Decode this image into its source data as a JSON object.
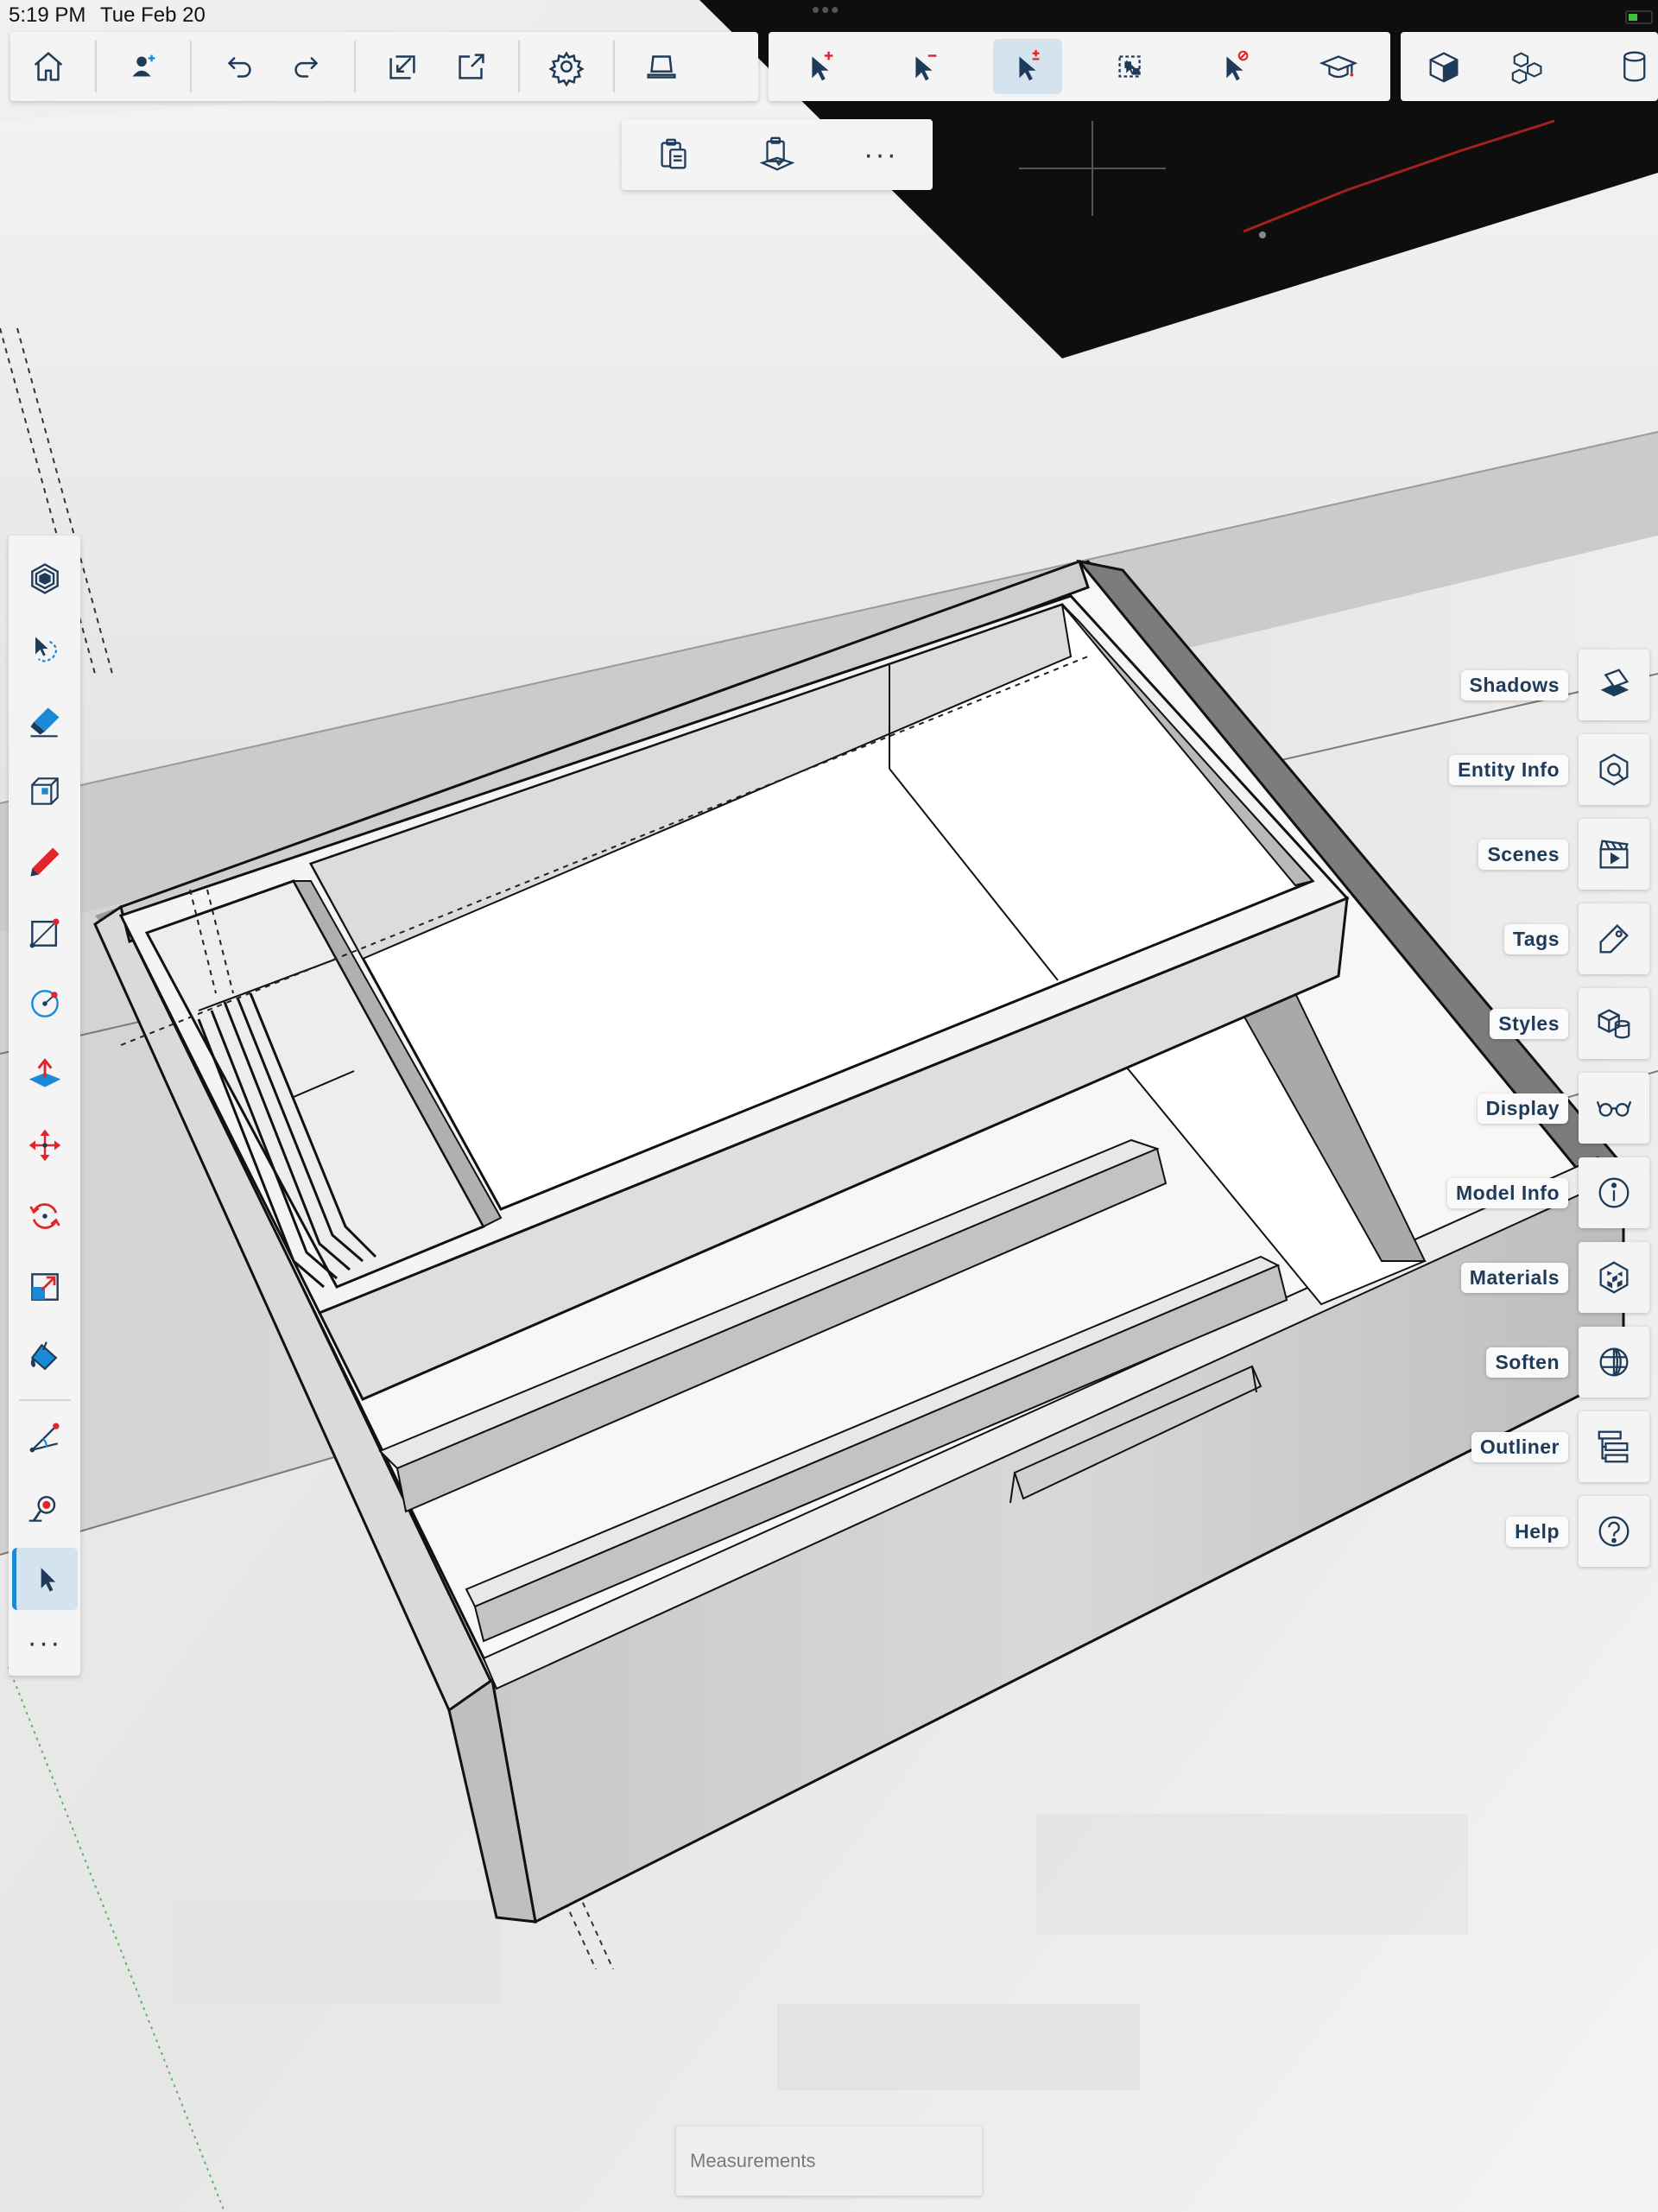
{
  "status_bar": {
    "time": "5:19 PM",
    "date": "Tue Feb 20",
    "dots": "•••"
  },
  "top_toolbar": {
    "file_group": [
      {
        "name": "home-button",
        "icon": "home-icon"
      },
      {
        "name": "collaborate-button",
        "icon": "user-add-icon"
      },
      {
        "name": "undo-button",
        "icon": "undo-icon"
      },
      {
        "name": "redo-button",
        "icon": "redo-icon"
      },
      {
        "name": "import-button",
        "icon": "import-icon"
      },
      {
        "name": "export-button",
        "icon": "export-icon"
      },
      {
        "name": "settings-button",
        "icon": "gear-icon"
      },
      {
        "name": "view-button",
        "icon": "laptop-icon"
      }
    ],
    "select_group": [
      {
        "name": "select-add-button",
        "icon": "cursor-plus-icon"
      },
      {
        "name": "select-subtract-button",
        "icon": "cursor-minus-icon"
      },
      {
        "name": "select-toggle-button",
        "icon": "cursor-plus-minus-icon",
        "active": true
      },
      {
        "name": "select-all-button",
        "icon": "select-grid-icon"
      },
      {
        "name": "select-none-button",
        "icon": "cursor-block-icon"
      },
      {
        "name": "instructor-button",
        "icon": "graduation-cap-icon"
      }
    ],
    "view_group": [
      {
        "name": "standard-views-button",
        "icon": "cube-icon"
      },
      {
        "name": "components-button",
        "icon": "components-icon"
      },
      {
        "name": "library-button",
        "icon": "cylinder-icon"
      }
    ]
  },
  "sub_toolbar": {
    "items": [
      {
        "name": "paste-button",
        "icon": "clipboard-icon"
      },
      {
        "name": "paste-in-place-button",
        "icon": "clipboard-place-icon"
      }
    ],
    "more_label": "···"
  },
  "left_tools": {
    "items": [
      {
        "name": "orbit-tool",
        "icon": "orbit-icon"
      },
      {
        "name": "lasso-select-tool",
        "icon": "lasso-icon"
      },
      {
        "name": "eraser-tool",
        "icon": "eraser-icon"
      },
      {
        "name": "shape-tool",
        "icon": "box-icon"
      },
      {
        "name": "pencil-tool",
        "icon": "pencil-icon"
      },
      {
        "name": "rectangle-tool",
        "icon": "rectangle-icon"
      },
      {
        "name": "circle-tool",
        "icon": "circle-icon"
      },
      {
        "name": "push-pull-tool",
        "icon": "push-pull-icon"
      },
      {
        "name": "move-tool",
        "icon": "move-arrows-icon"
      },
      {
        "name": "rotate-tool",
        "icon": "rotate-icon"
      },
      {
        "name": "scale-tool",
        "icon": "scale-icon"
      },
      {
        "name": "paint-tool",
        "icon": "paint-bucket-icon"
      },
      {
        "name": "tape-measure-tool",
        "icon": "protractor-icon"
      },
      {
        "name": "walk-tool",
        "icon": "position-icon"
      },
      {
        "name": "select-tool",
        "icon": "cursor-icon",
        "active": true
      }
    ],
    "more_label": "···"
  },
  "right_panels": [
    {
      "label": "Shadows",
      "icon": "shadows-icon"
    },
    {
      "label": "Entity Info",
      "icon": "entity-info-icon"
    },
    {
      "label": "Scenes",
      "icon": "scenes-icon"
    },
    {
      "label": "Tags",
      "icon": "tag-icon"
    },
    {
      "label": "Styles",
      "icon": "styles-icon"
    },
    {
      "label": "Display",
      "icon": "glasses-icon"
    },
    {
      "label": "Model Info",
      "icon": "info-icon"
    },
    {
      "label": "Materials",
      "icon": "materials-icon"
    },
    {
      "label": "Soften",
      "icon": "soften-icon"
    },
    {
      "label": "Outliner",
      "icon": "outliner-icon"
    },
    {
      "label": "Help",
      "icon": "help-icon"
    }
  ],
  "measurements": {
    "placeholder": "Measurements"
  },
  "colors": {
    "icon_primary": "#1f3b5a",
    "icon_accent": "#e0262a",
    "active_bg": "#d5e3ef",
    "active_indicator": "#1a8ad6",
    "toolbar_bg": "#f4f4f4"
  }
}
